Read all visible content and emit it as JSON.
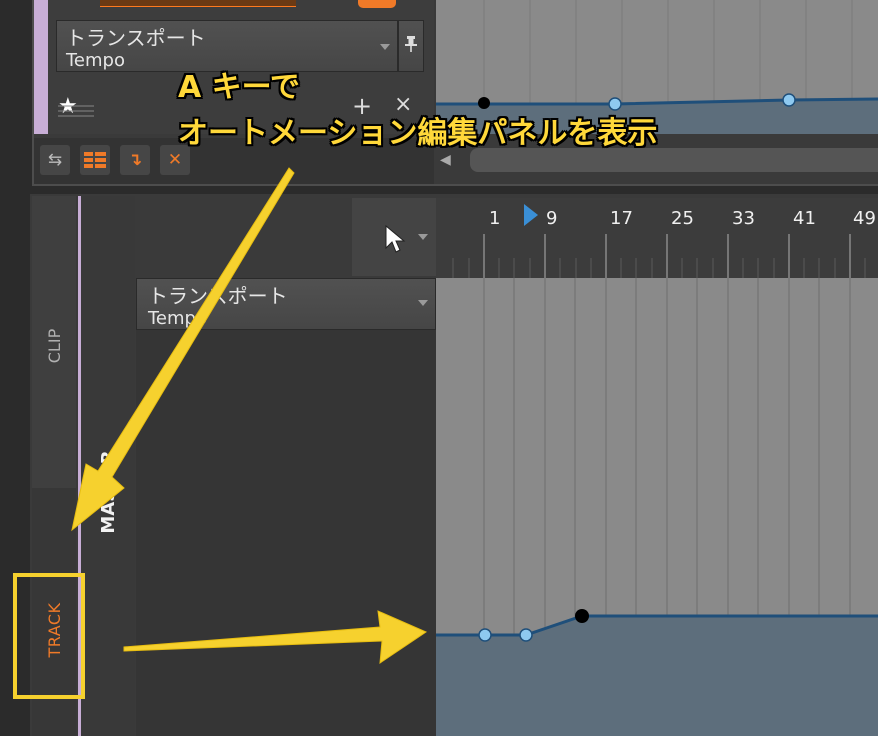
{
  "top_panel": {
    "param_name": "トランスポート",
    "param_sub": "Tempo",
    "star_icon": "★",
    "add_label": "+",
    "close_label": "×",
    "pin_icon": "pin-icon"
  },
  "toolbar": {
    "buttons": [
      "swap-icon",
      "clips-icon",
      "insert-icon",
      "delete-icon"
    ]
  },
  "tabs": {
    "clip": "CLIP",
    "track": "TRACK"
  },
  "master_label": "MASTER",
  "ruler": {
    "ticks": [
      "1",
      "9",
      "17",
      "25",
      "33",
      "41",
      "49"
    ]
  },
  "bottom_panel": {
    "param_name": "トランスポート",
    "param_sub": "Tempo"
  },
  "annotation": {
    "line1": "A キーで",
    "line2": "オートメーション編集パネルを表示"
  },
  "colors": {
    "accent_orange": "#f07a28",
    "highlight_yellow": "#f6d12e",
    "automation_blue": "#1f4f7a",
    "track_purple": "#c8aed6"
  }
}
